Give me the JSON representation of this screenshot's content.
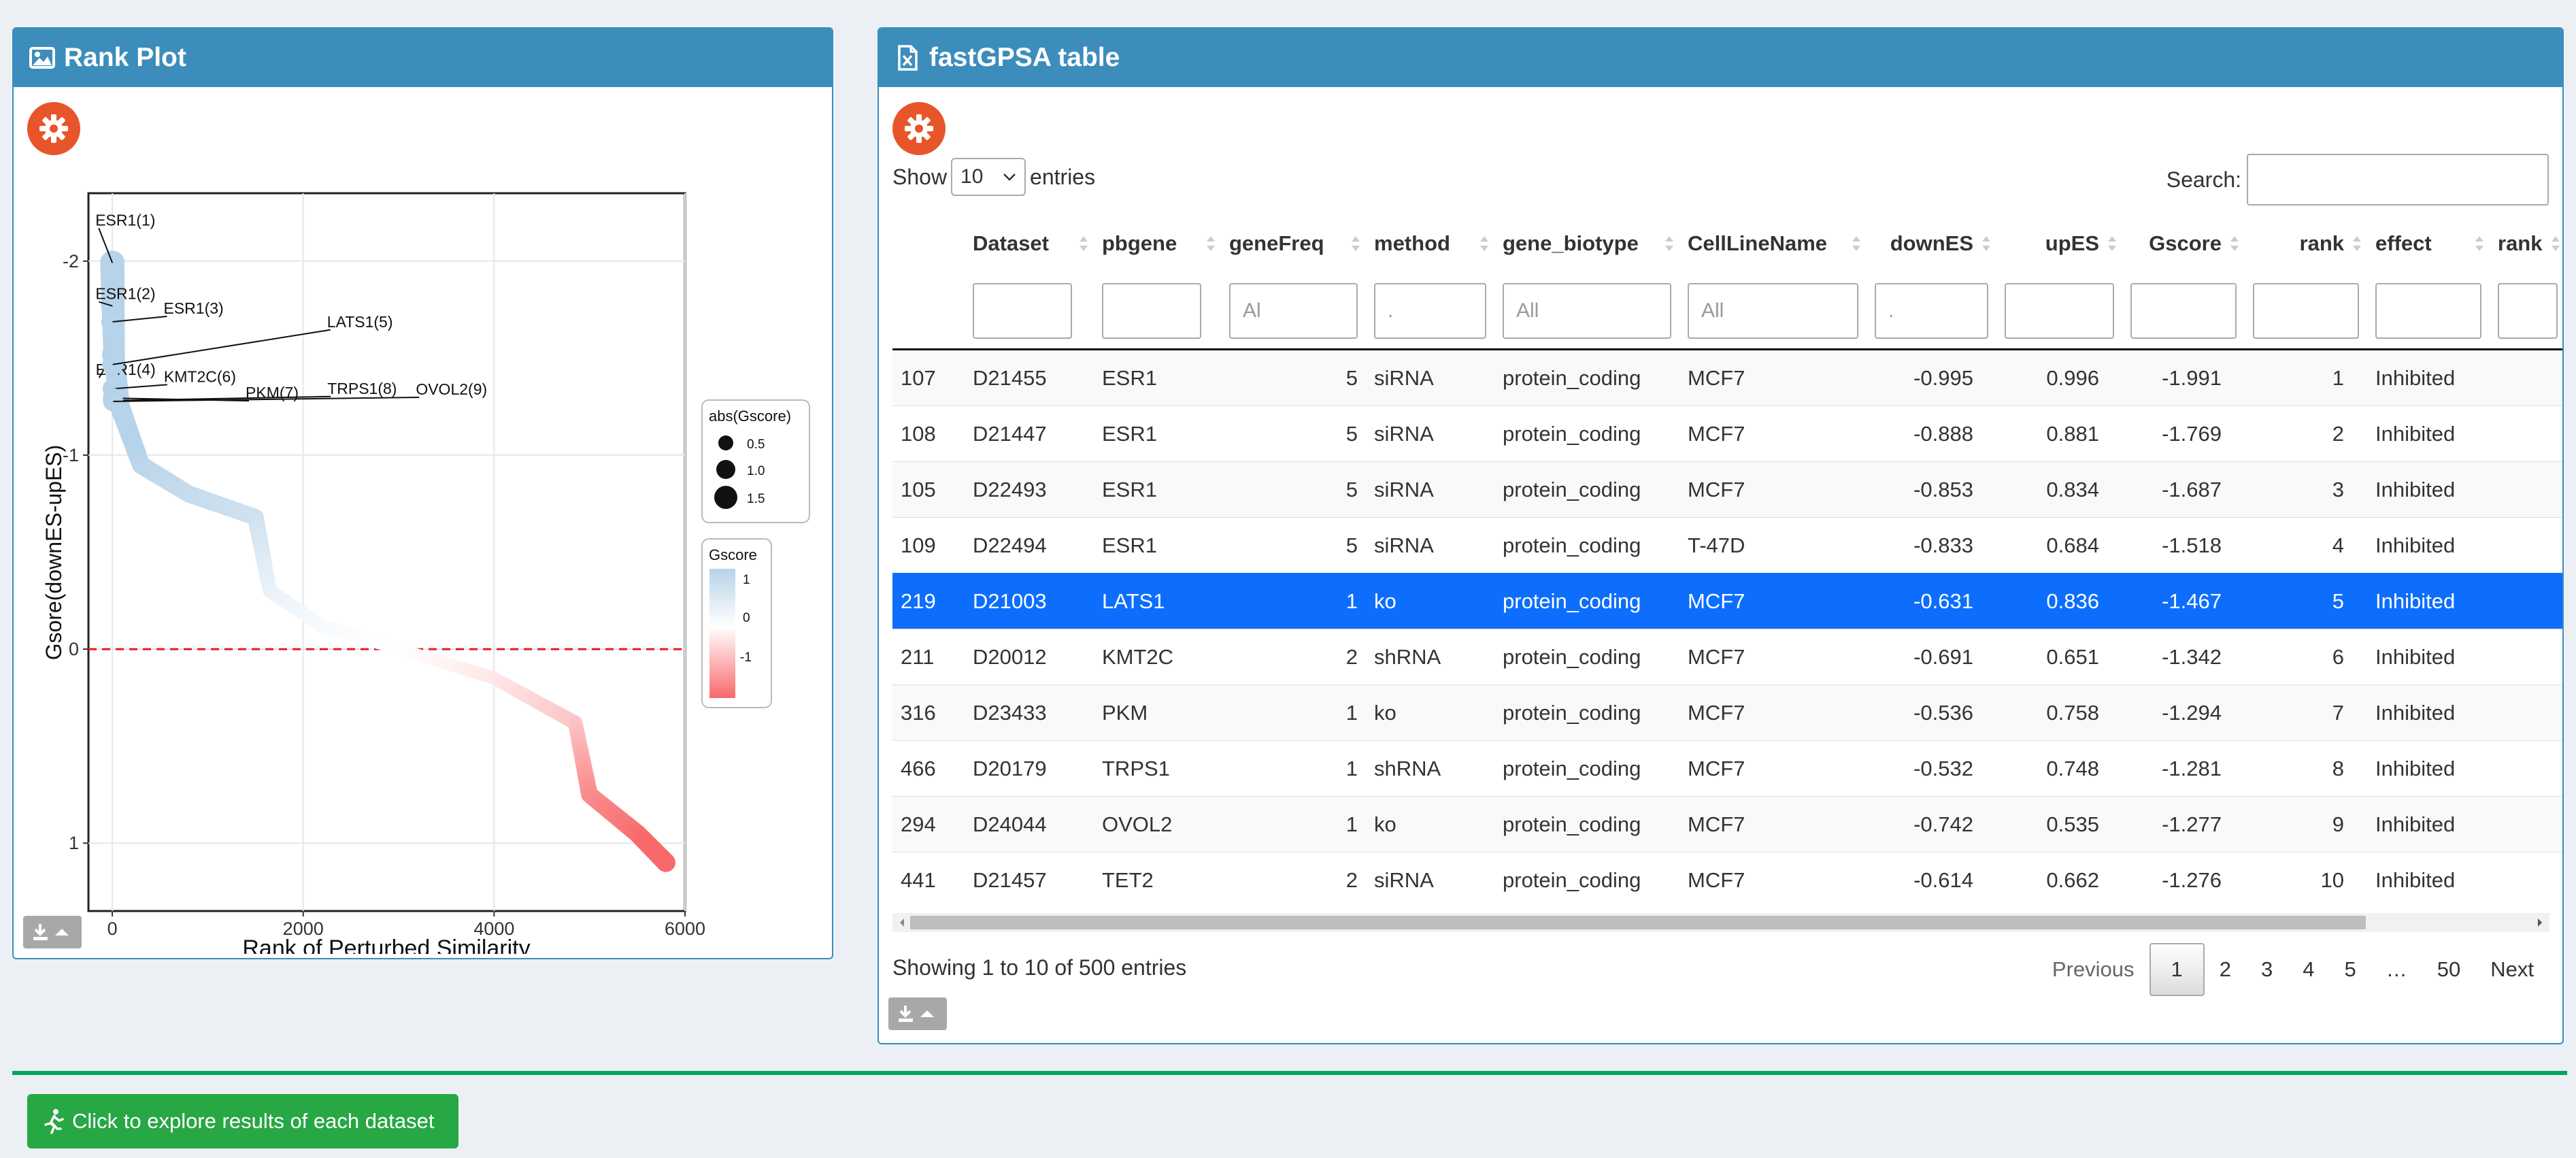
{
  "rank_panel": {
    "title": "Rank Plot",
    "header_icon": "image-icon",
    "settings_icon": "gear-icon",
    "download_icon": "download-icon"
  },
  "chart_data": {
    "type": "scatter",
    "xlabel": "Rank of Perturbed Similarity",
    "ylabel": "Gsore(downES-upES)",
    "x_ticks": [
      "0",
      "2000",
      "4000",
      "6000"
    ],
    "y_ticks": [
      "-2",
      "-1",
      "0",
      "1"
    ],
    "xlim": [
      -250,
      6000
    ],
    "ylim_reversed": [
      -2.35,
      1.35
    ],
    "reference_line": {
      "y": 0,
      "color": "#e41a1c",
      "style": "dashed"
    },
    "curve_points": [
      {
        "x": 0,
        "y": -1.991
      },
      {
        "x": 20,
        "y": -1.5
      },
      {
        "x": 80,
        "y": -1.25
      },
      {
        "x": 300,
        "y": -0.95
      },
      {
        "x": 800,
        "y": -0.8
      },
      {
        "x": 1500,
        "y": -0.68
      },
      {
        "x": 1650,
        "y": -0.3
      },
      {
        "x": 2200,
        "y": -0.12
      },
      {
        "x": 3000,
        "y": 0.0
      },
      {
        "x": 4000,
        "y": 0.15
      },
      {
        "x": 4850,
        "y": 0.38
      },
      {
        "x": 5000,
        "y": 0.75
      },
      {
        "x": 5500,
        "y": 0.95
      },
      {
        "x": 5800,
        "y": 1.1
      }
    ],
    "labeled_points": [
      {
        "label": "ESR1(1)",
        "x": 1,
        "y": -1.991
      },
      {
        "label": "ESR1(2)",
        "x": 2,
        "y": -1.769
      },
      {
        "label": "ESR1(3)",
        "x": 3,
        "y": -1.687
      },
      {
        "label": "ESR1(4)",
        "x": 4,
        "y": -1.518
      },
      {
        "label": "LATS1(5)",
        "x": 5,
        "y": -1.467
      },
      {
        "label": "KMT2C(6)",
        "x": 6,
        "y": -1.342
      },
      {
        "label": "PKM(7)",
        "x": 7,
        "y": -1.294
      },
      {
        "label": "TRPS1(8)",
        "x": 8,
        "y": -1.281
      },
      {
        "label": "OVOL2(9)",
        "x": 9,
        "y": -1.277
      }
    ],
    "legend_size": {
      "title": "abs(Gscore)",
      "entries": [
        "0.5",
        "1.0",
        "1.5"
      ]
    },
    "legend_color": {
      "title": "Gscore",
      "entries": [
        "1",
        "0",
        "-1"
      ],
      "low_color": "#f8696b",
      "mid_color": "#ffffff",
      "high_color": "#b7d3e9"
    }
  },
  "table_panel": {
    "title": "fastGPSA table",
    "header_icon": "file-excel-icon",
    "show_label": "Show",
    "entries_value": "10",
    "entries_label": "entries",
    "search_label": "Search:",
    "columns": [
      "",
      "Dataset",
      "pbgene",
      "geneFreq",
      "method",
      "gene_biotype",
      "CellLineName",
      "downES",
      "upES",
      "Gscore",
      "rank",
      "effect",
      "rank"
    ],
    "filters": [
      "",
      "",
      "",
      "Al",
      ".",
      "All",
      "All",
      ".",
      "",
      "",
      "",
      "",
      ""
    ],
    "rows": [
      [
        "107",
        "D21455",
        "ESR1",
        "5",
        "siRNA",
        "protein_coding",
        "MCF7",
        "-0.995",
        "0.996",
        "-1.991",
        "1",
        "Inhibited"
      ],
      [
        "108",
        "D21447",
        "ESR1",
        "5",
        "siRNA",
        "protein_coding",
        "MCF7",
        "-0.888",
        "0.881",
        "-1.769",
        "2",
        "Inhibited"
      ],
      [
        "105",
        "D22493",
        "ESR1",
        "5",
        "siRNA",
        "protein_coding",
        "MCF7",
        "-0.853",
        "0.834",
        "-1.687",
        "3",
        "Inhibited"
      ],
      [
        "109",
        "D22494",
        "ESR1",
        "5",
        "siRNA",
        "protein_coding",
        "T-47D",
        "-0.833",
        "0.684",
        "-1.518",
        "4",
        "Inhibited"
      ],
      [
        "219",
        "D21003",
        "LATS1",
        "1",
        "ko",
        "protein_coding",
        "MCF7",
        "-0.631",
        "0.836",
        "-1.467",
        "5",
        "Inhibited"
      ],
      [
        "211",
        "D20012",
        "KMT2C",
        "2",
        "shRNA",
        "protein_coding",
        "MCF7",
        "-0.691",
        "0.651",
        "-1.342",
        "6",
        "Inhibited"
      ],
      [
        "316",
        "D23433",
        "PKM",
        "1",
        "ko",
        "protein_coding",
        "MCF7",
        "-0.536",
        "0.758",
        "-1.294",
        "7",
        "Inhibited"
      ],
      [
        "466",
        "D20179",
        "TRPS1",
        "1",
        "shRNA",
        "protein_coding",
        "MCF7",
        "-0.532",
        "0.748",
        "-1.281",
        "8",
        "Inhibited"
      ],
      [
        "294",
        "D24044",
        "OVOL2",
        "1",
        "ko",
        "protein_coding",
        "MCF7",
        "-0.742",
        "0.535",
        "-1.277",
        "9",
        "Inhibited"
      ],
      [
        "441",
        "D21457",
        "TET2",
        "2",
        "siRNA",
        "protein_coding",
        "MCF7",
        "-0.614",
        "0.662",
        "-1.276",
        "10",
        "Inhibited"
      ]
    ],
    "selected_row": 4,
    "info": "Showing 1 to 10 of 500 entries",
    "pagination": {
      "previous": "Previous",
      "pages": [
        "1",
        "2",
        "3",
        "4",
        "5",
        "…",
        "50"
      ],
      "current": "1",
      "next": "Next"
    }
  },
  "explore_button": {
    "label": "Click to explore results of each dataset",
    "icon": "running-person-icon"
  },
  "colors": {
    "header": "#3c8dbc",
    "gear": "#e8552a",
    "selected_row": "#0d6efd",
    "explore": "#28a745",
    "divider": "#00a65a"
  }
}
